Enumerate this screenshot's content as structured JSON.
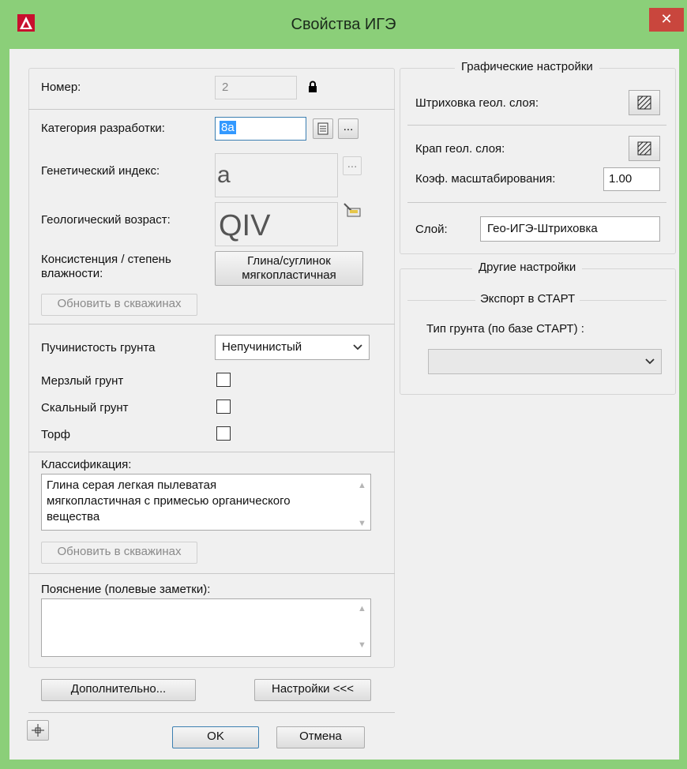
{
  "window": {
    "title": "Свойства ИГЭ",
    "close_glyph": "✕",
    "accent_color": "#8bcf79"
  },
  "left": {
    "number_label": "Номер:",
    "number_value": "2",
    "category_label": "Категория разработки:",
    "category_value": "8а",
    "ellipsis": "...",
    "genetic_label": "Генетический индекс:",
    "genetic_value": "a",
    "age_label": "Геологический возраст:",
    "age_value": "QIV",
    "consistency_label_1": "Консистенция / степень",
    "consistency_label_2": "влажности:",
    "consistency_value_1": "Глина/суглинок",
    "consistency_value_2": "мягкопластичная",
    "update_wells_1": "Обновить в скважинах",
    "heaving_label": "Пучинистость грунта",
    "heaving_value": "Непучинистый",
    "frozen_label": "Мерзлый грунт",
    "rock_label": "Скальный грунт",
    "peat_label": "Торф",
    "classification_label": "Классификация:",
    "classification_lines": [
      "Глина серая легкая пылеватая",
      "мягкопластичная с примесью органического",
      "вещества"
    ],
    "update_wells_2": "Обновить в скважинах",
    "notes_label": "Пояснение (полевые заметки):",
    "notes_value": "",
    "more_button": "Дополнительно...",
    "settings_button": "Настройки <<<"
  },
  "right": {
    "graphics_title": "Графические настройки",
    "hatch_label": "Штриховка геол. слоя:",
    "speckle_label": "Крап геол. слоя:",
    "scale_label": "Коэф. масштабирования:",
    "scale_value": "1.00",
    "layer_label": "Слой:",
    "layer_value": "Гео-ИГЭ-Штриховка",
    "other_title": "Другие настройки",
    "export_title": "Экспорт в СТАРТ",
    "soil_type_label": "Тип грунта (по базе СТАРТ) :",
    "soil_type_value": ""
  },
  "bottom": {
    "ok_button": "OK",
    "cancel_button": "Отмена"
  },
  "icons": {
    "app": "autocad-logo-icon",
    "lock": "lock-icon",
    "list": "list-icon",
    "pick": "pick-icon",
    "hatch": "hatch-pattern-icon",
    "crosshair": "crosshair-icon",
    "dropdown": "chevron-down-icon",
    "scroll_up": "scroll-up-icon",
    "scroll_down": "scroll-down-icon"
  }
}
